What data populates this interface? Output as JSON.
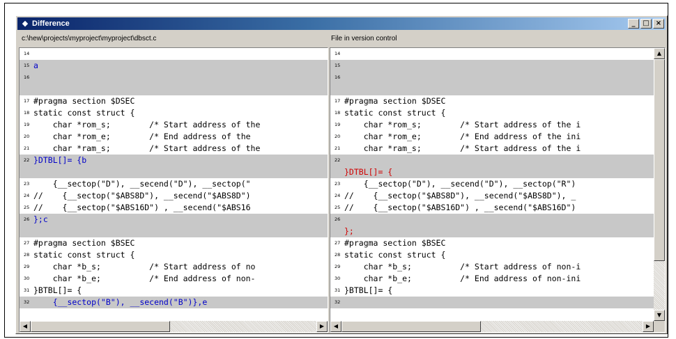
{
  "window": {
    "title": "Difference",
    "minimize_label": "_",
    "maximize_label": "□",
    "close_label": "×"
  },
  "left_pane": {
    "header": "c:\\hew\\projects\\myproject\\myproject\\dbsct.c",
    "lines": [
      {
        "num": "14",
        "text": "",
        "style": "normal"
      },
      {
        "num": "15",
        "text": "a",
        "style": "diff-blue"
      },
      {
        "num": "16",
        "text": "",
        "style": "diff-blue"
      },
      {
        "num": "",
        "text": "",
        "style": "diff-blue"
      },
      {
        "num": "17",
        "text": "#pragma section $DSEC",
        "style": "normal"
      },
      {
        "num": "18",
        "text": "static const struct {",
        "style": "normal"
      },
      {
        "num": "19",
        "text": "    char *rom_s;        /* Start address of the",
        "style": "normal"
      },
      {
        "num": "20",
        "text": "    char *rom_e;        /* End address of the",
        "style": "normal"
      },
      {
        "num": "21",
        "text": "    char *ram_s;        /* Start address of the",
        "style": "normal"
      },
      {
        "num": "22",
        "text": "}DTBL[]= {b",
        "style": "diff-blue"
      },
      {
        "num": "",
        "text": "",
        "style": "diff-blue"
      },
      {
        "num": "23",
        "text": "    {__sectop(\"D\"), __secend(\"D\"), __sectop(\"",
        "style": "normal"
      },
      {
        "num": "24",
        "text": "//    {__sectop(\"$ABS8D\"), __secend(\"$ABS8D\")",
        "style": "normal"
      },
      {
        "num": "25",
        "text": "//    {__sectop(\"$ABS16D\") , __secend(\"$ABS16",
        "style": "normal"
      },
      {
        "num": "26",
        "text": "};c",
        "style": "diff-blue"
      },
      {
        "num": "",
        "text": "",
        "style": "diff-blue"
      },
      {
        "num": "27",
        "text": "#pragma section $BSEC",
        "style": "normal"
      },
      {
        "num": "28",
        "text": "static const struct {",
        "style": "normal"
      },
      {
        "num": "29",
        "text": "    char *b_s;          /* Start address of no",
        "style": "normal"
      },
      {
        "num": "30",
        "text": "    char *b_e;          /* End address of non-",
        "style": "normal"
      },
      {
        "num": "31",
        "text": "}BTBL[]= {",
        "style": "normal"
      },
      {
        "num": "32",
        "text": "    {__sectop(\"B\"), __secend(\"B\")},e",
        "style": "diff-blue"
      }
    ]
  },
  "right_pane": {
    "header": "File in version control",
    "lines": [
      {
        "num": "14",
        "text": "",
        "style": "normal"
      },
      {
        "num": "15",
        "text": "",
        "style": "diff"
      },
      {
        "num": "16",
        "text": "",
        "style": "diff"
      },
      {
        "num": "",
        "text": "",
        "style": "diff"
      },
      {
        "num": "17",
        "text": "#pragma section $DSEC",
        "style": "normal"
      },
      {
        "num": "18",
        "text": "static const struct {",
        "style": "normal"
      },
      {
        "num": "19",
        "text": "    char *rom_s;        /* Start address of the i",
        "style": "normal"
      },
      {
        "num": "20",
        "text": "    char *rom_e;        /* End address of the ini",
        "style": "normal"
      },
      {
        "num": "21",
        "text": "    char *ram_s;        /* Start address of the i",
        "style": "normal"
      },
      {
        "num": "22",
        "text": "",
        "style": "diff-red"
      },
      {
        "num": "",
        "text": "}DTBL[]= {",
        "style": "diff-red"
      },
      {
        "num": "23",
        "text": "    {__sectop(\"D\"), __secend(\"D\"), __sectop(\"R\")",
        "style": "normal"
      },
      {
        "num": "24",
        "text": "//    {__sectop(\"$ABS8D\"), __secend(\"$ABS8D\"), _",
        "style": "normal"
      },
      {
        "num": "25",
        "text": "//    {__sectop(\"$ABS16D\") , __secend(\"$ABS16D\")",
        "style": "normal"
      },
      {
        "num": "26",
        "text": "",
        "style": "diff-red"
      },
      {
        "num": "",
        "text": "};",
        "style": "diff-red"
      },
      {
        "num": "27",
        "text": "#pragma section $BSEC",
        "style": "normal"
      },
      {
        "num": "28",
        "text": "static const struct {",
        "style": "normal"
      },
      {
        "num": "29",
        "text": "    char *b_s;          /* Start address of non-i",
        "style": "normal"
      },
      {
        "num": "30",
        "text": "    char *b_e;          /* End address of non-ini",
        "style": "normal"
      },
      {
        "num": "31",
        "text": "}BTBL[]= {",
        "style": "normal"
      },
      {
        "num": "32",
        "text": "",
        "style": "diff-red"
      }
    ]
  },
  "scroll": {
    "left_arrow": "◀",
    "right_arrow": "▶",
    "up_arrow": "▲",
    "down_arrow": "▼"
  },
  "colors": {
    "diff_background": "#c8c8c8",
    "left_change_text": "#0000c8",
    "right_change_text": "#d00000",
    "titlebar_start": "#0a246a",
    "titlebar_end": "#a6caf0"
  },
  "icons": {
    "window_icon": "diff-window-icon"
  }
}
